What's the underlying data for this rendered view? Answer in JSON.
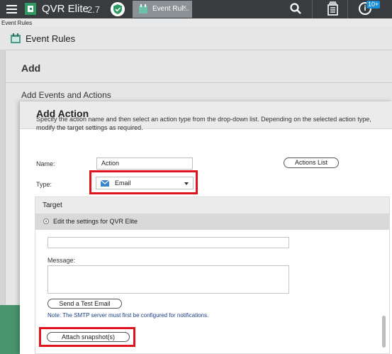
{
  "topbar": {
    "app_title": "QVR Elite",
    "app_version": "2.7",
    "active_tab_label": "Event Rul...",
    "tab_close": "×",
    "info_glyph": "i",
    "notification_badge": "10+"
  },
  "breadcrumb": "Event Rules",
  "page": {
    "title": "Event Rules"
  },
  "background": {
    "add_heading": "Add",
    "events_heading": "Add Events and Actions"
  },
  "modal": {
    "title": "Add Action",
    "description": "Specify the action name and then select an action type from the drop-down list. Depending on the selected action type, modify the target settings as required.",
    "name_label": "Name:",
    "name_value": "Action",
    "actions_list_button": "Actions List",
    "type_label": "Type:",
    "type_value": "Email",
    "target": {
      "title": "Target",
      "option_label": "Edit the settings for QVR Elite",
      "message_label": "Message:",
      "test_email_button": "Send a Test Email",
      "smtp_note": "Note: The SMTP server must first be configured for notifications.",
      "snapshot_button": "Attach snapshot(s)"
    }
  },
  "colors": {
    "topbar": "#383c3f",
    "highlight": "#e0141e",
    "note_text": "#1a3f86",
    "badge": "#1a8ed6",
    "side_strip": "#47946d"
  },
  "icons": [
    "menu-icon",
    "qvr-logo-icon",
    "shield-icon",
    "tab-app-icon",
    "search-icon",
    "notes-icon",
    "info-icon",
    "event-rules-icon",
    "email-icon",
    "dropdown-caret-icon"
  ]
}
